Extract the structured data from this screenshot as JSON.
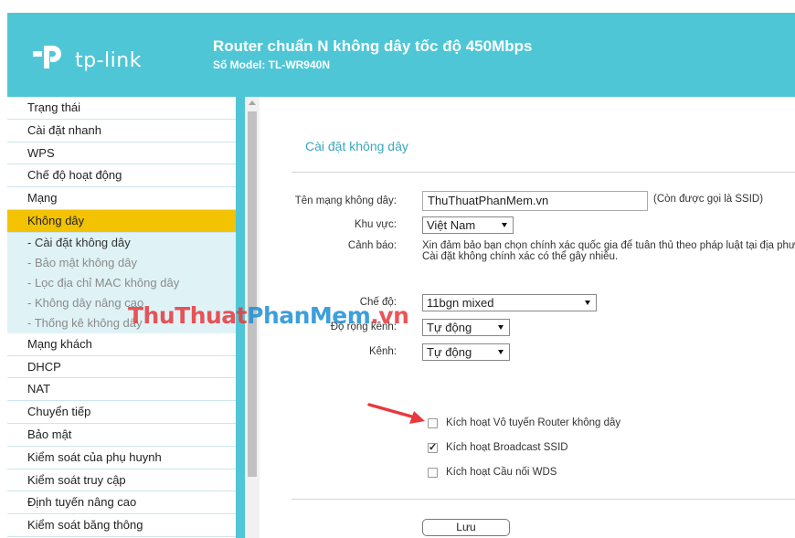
{
  "header": {
    "brand": "tp-link",
    "title": "Router chuẩn N không dây tốc độ 450Mbps",
    "model": "Số Model: TL-WR940N",
    "bg_color": "#4fc6d6"
  },
  "sidebar": {
    "items": [
      {
        "label": "Trạng thái"
      },
      {
        "label": "Cài đặt nhanh"
      },
      {
        "label": "WPS"
      },
      {
        "label": "Chế độ hoạt động"
      },
      {
        "label": "Mạng"
      },
      {
        "label": "Không dây",
        "active": true
      }
    ],
    "sub_items": [
      {
        "label": "- Cài đặt không dây",
        "current": true
      },
      {
        "label": "- Bảo mật không dây"
      },
      {
        "label": "- Lọc địa chỉ MAC không dây"
      },
      {
        "label": "- Không dây nâng cao"
      },
      {
        "label": "- Thống kê không dây"
      }
    ],
    "items_after": [
      {
        "label": "Mạng khách"
      },
      {
        "label": "DHCP"
      },
      {
        "label": "NAT"
      },
      {
        "label": "Chuyển tiếp"
      },
      {
        "label": "Bảo mật"
      },
      {
        "label": "Kiểm soát của phụ huynh"
      },
      {
        "label": "Kiểm soát truy cập"
      },
      {
        "label": "Định tuyến nâng cao"
      },
      {
        "label": "Kiểm soát băng thông"
      }
    ],
    "active_color": "#f3c200"
  },
  "main": {
    "section_title": "Cài đặt không dây",
    "ssid_label": "Tên mạng không dây:",
    "ssid_value": "ThuThuatPhanMem.vn",
    "ssid_hint": "(Còn được gọi là SSID)",
    "region_label": "Khu vực:",
    "region_value": "Việt Nam",
    "warning_label": "Cảnh báo:",
    "warning_line1": "Xin đảm bảo bạn chọn chính xác quốc gia để tuân thủ theo pháp luật tại địa phươ",
    "warning_line2": "Cài đặt không chính xác có thể gây nhiễu.",
    "mode_label": "Chế độ:",
    "mode_value": "11bgn mixed",
    "width_label": "Độ rộng kênh:",
    "width_value": "Tự động",
    "channel_label": "Kênh:",
    "channel_value": "Tự động",
    "checkboxes": [
      {
        "label": "Kích hoạt Vô tuyến Router không dây",
        "checked": false
      },
      {
        "label": "Kích hoạt Broadcast SSID",
        "checked": true
      },
      {
        "label": "Kích hoạt Cầu nối WDS",
        "checked": false
      }
    ],
    "save_label": "Lưu",
    "title_color": "#3aa5c0"
  },
  "watermark": {
    "part1": "ThuThuat",
    "part2": "PhanMem",
    "part3": ".vn"
  }
}
